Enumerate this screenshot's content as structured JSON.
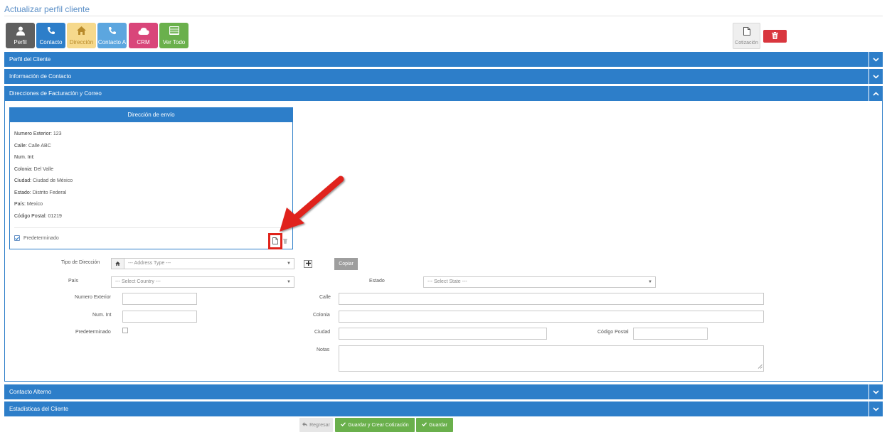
{
  "page": {
    "title": "Actualizar perfil cliente"
  },
  "toolbar": {
    "buttons": [
      {
        "label": "Perfil",
        "icon": "user-icon",
        "color": "#5f5f5f"
      },
      {
        "label": "Contacto",
        "icon": "phone-icon",
        "color": "#2d7ec9"
      },
      {
        "label": "Dirección",
        "icon": "home-icon",
        "color": "#f6d98c"
      },
      {
        "label": "Contacto A",
        "icon": "phone-icon",
        "color": "#5ca6df"
      },
      {
        "label": "CRM",
        "icon": "cloud-icon",
        "color": "#d9467a"
      },
      {
        "label": "Ver Todo",
        "icon": "list-icon",
        "color": "#6ab04c"
      }
    ],
    "cotizacion_label": "Cotización",
    "delete_icon": "trash-icon",
    "delete_color": "#d9363e"
  },
  "sections": {
    "perfil": "Perfil del Cliente",
    "contacto": "Información de Contacto",
    "direcciones": "Direcciones de Facturación y Correo",
    "alterno": "Contacto Alterno",
    "estadisticas": "Estadísticas del Cliente"
  },
  "address_card": {
    "header": "Dirección de envío",
    "fields": [
      {
        "key": "Numero Exterior:",
        "value": "123"
      },
      {
        "key": "Calle:",
        "value": "Calle ABC"
      },
      {
        "key": "Num. Int:",
        "value": ""
      },
      {
        "key": "Colonia:",
        "value": "Del Valle"
      },
      {
        "key": "Ciudad:",
        "value": "Ciudad de México"
      },
      {
        "key": "Estado:",
        "value": "Distrito Federal"
      },
      {
        "key": "País:",
        "value": "Mexico"
      },
      {
        "key": "Código Postal:",
        "value": "01219"
      }
    ],
    "default_label": "Predeterminado",
    "default_checked": true
  },
  "form": {
    "tipo_label": "Tipo de Dirección",
    "tipo_placeholder": "--- Address Type ---",
    "copiar_label": "Copiar",
    "pais_label": "País",
    "pais_placeholder": "--- Select Country ---",
    "estado_label": "Estado",
    "estado_placeholder": "--- Select State ---",
    "numext_label": "Numero Exterior",
    "calle_label": "Calle",
    "numint_label": "Num. Int",
    "colonia_label": "Colonia",
    "predeterminado_label": "Predeterminado",
    "ciudad_label": "Ciudad",
    "cp_label": "Código Postal",
    "notas_label": "Notas"
  },
  "footer": {
    "regresar_label": "Regresar",
    "guardar_crear_label": "Guardar y Crear Cotización",
    "guardar_label": "Guardar"
  },
  "colors": {
    "primary": "#2d7ec9",
    "success": "#6ab04c",
    "danger": "#d9363e",
    "highlight": "#e0231b"
  }
}
